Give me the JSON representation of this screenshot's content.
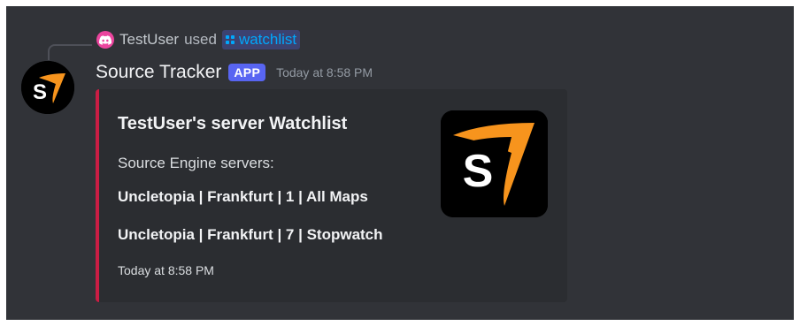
{
  "reply": {
    "user": "TestUser",
    "used_text": "used",
    "command": "watchlist",
    "avatar_icon": "discord-icon"
  },
  "message": {
    "author": "Source Tracker",
    "badge": "APP",
    "timestamp": "Today at 8:58 PM",
    "avatar_icon": "source-logo-icon"
  },
  "embed": {
    "accent_color": "#ca1d44",
    "title": "TestUser's server Watchlist",
    "description": "Source Engine servers:",
    "fields": [
      "Uncletopia | Frankfurt | 1 | All Maps",
      "Uncletopia | Frankfurt | 7 | Stopwatch"
    ],
    "footer": "Today at 8:58 PM",
    "thumbnail_icon": "source-logo-icon"
  },
  "colors": {
    "background": "#313338",
    "embed_background": "#2b2d31",
    "app_badge": "#5865f2",
    "logo_orange": "#f7941d"
  }
}
